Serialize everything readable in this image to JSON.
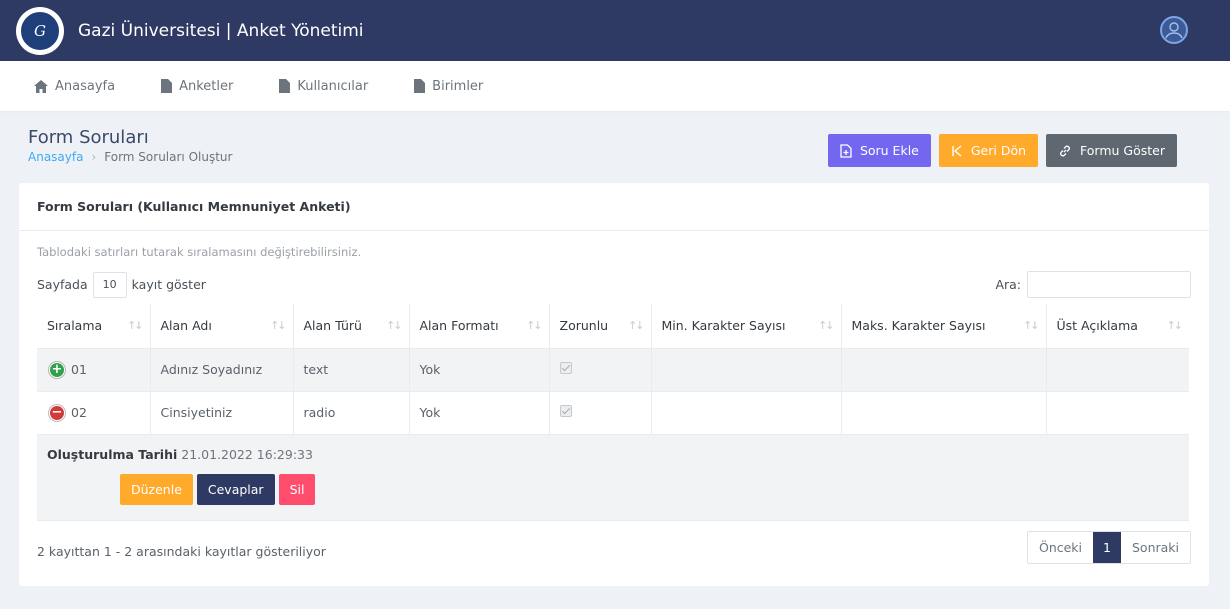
{
  "app": {
    "title": "Gazi Üniversitesi | Anket Yönetimi"
  },
  "nav": [
    {
      "label": "Anasayfa",
      "icon": "home-icon"
    },
    {
      "label": "Anketler",
      "icon": "file-icon"
    },
    {
      "label": "Kullanıcılar",
      "icon": "file-icon"
    },
    {
      "label": "Birimler",
      "icon": "file-icon"
    }
  ],
  "page": {
    "title": "Form Soruları",
    "breadcrumb_home": "Anasayfa",
    "breadcrumb_current": "Form Soruları Oluştur"
  },
  "actions": {
    "add_question": "Soru Ekle",
    "back": "Geri Dön",
    "show_form": "Formu Göster"
  },
  "card": {
    "title": "Form Soruları (Kullanıcı Memnuniyet Anketi)",
    "hint": "Tablodaki satırları tutarak sıralamasını değiştirebilirsiniz."
  },
  "table_controls": {
    "length_prefix": "Sayfada",
    "length_value": "10",
    "length_suffix": "kayıt göster",
    "search_label": "Ara:"
  },
  "columns": [
    "Sıralama",
    "Alan Adı",
    "Alan Türü",
    "Alan Formatı",
    "Zorunlu",
    "Min. Karakter Sayısı",
    "Maks. Karakter Sayısı",
    "Üst Açıklama"
  ],
  "rows": [
    {
      "order": "01",
      "name": "Adınız Soyadınız",
      "type": "text",
      "format": "Yok",
      "required": true,
      "min": "",
      "max": "",
      "desc": ""
    },
    {
      "order": "02",
      "name": "Cinsiyetiniz",
      "type": "radio",
      "format": "Yok",
      "required": true,
      "min": "",
      "max": "",
      "desc": ""
    }
  ],
  "detail": {
    "created_label": "Oluşturulma Tarihi",
    "created_value": "21.01.2022 16:29:33",
    "edit": "Düzenle",
    "answers": "Cevaplar",
    "delete": "Sil"
  },
  "footer": {
    "info": "2 kayıttan 1 - 2 arasındaki kayıtlar gösteriliyor",
    "prev": "Önceki",
    "page": "1",
    "next": "Sonraki"
  },
  "colors": {
    "primary": "#2e3a63",
    "purple": "#7367f0",
    "orange": "#ffaa2b",
    "grey": "#5f6770",
    "danger": "#ff4d6d",
    "link": "#3fa9f5"
  }
}
